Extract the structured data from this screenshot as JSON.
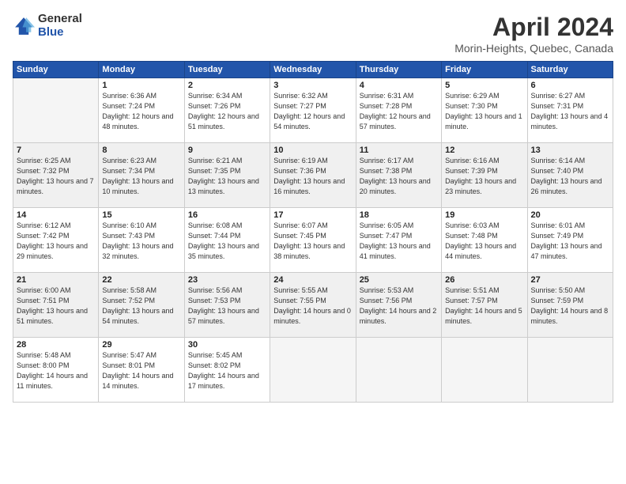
{
  "header": {
    "logo_general": "General",
    "logo_blue": "Blue",
    "month_title": "April 2024",
    "location": "Morin-Heights, Quebec, Canada"
  },
  "days_of_week": [
    "Sunday",
    "Monday",
    "Tuesday",
    "Wednesday",
    "Thursday",
    "Friday",
    "Saturday"
  ],
  "weeks": [
    [
      {
        "day": "",
        "empty": true
      },
      {
        "day": "1",
        "sunrise": "Sunrise: 6:36 AM",
        "sunset": "Sunset: 7:24 PM",
        "daylight": "Daylight: 12 hours and 48 minutes."
      },
      {
        "day": "2",
        "sunrise": "Sunrise: 6:34 AM",
        "sunset": "Sunset: 7:26 PM",
        "daylight": "Daylight: 12 hours and 51 minutes."
      },
      {
        "day": "3",
        "sunrise": "Sunrise: 6:32 AM",
        "sunset": "Sunset: 7:27 PM",
        "daylight": "Daylight: 12 hours and 54 minutes."
      },
      {
        "day": "4",
        "sunrise": "Sunrise: 6:31 AM",
        "sunset": "Sunset: 7:28 PM",
        "daylight": "Daylight: 12 hours and 57 minutes."
      },
      {
        "day": "5",
        "sunrise": "Sunrise: 6:29 AM",
        "sunset": "Sunset: 7:30 PM",
        "daylight": "Daylight: 13 hours and 1 minute."
      },
      {
        "day": "6",
        "sunrise": "Sunrise: 6:27 AM",
        "sunset": "Sunset: 7:31 PM",
        "daylight": "Daylight: 13 hours and 4 minutes."
      }
    ],
    [
      {
        "day": "7",
        "sunrise": "Sunrise: 6:25 AM",
        "sunset": "Sunset: 7:32 PM",
        "daylight": "Daylight: 13 hours and 7 minutes."
      },
      {
        "day": "8",
        "sunrise": "Sunrise: 6:23 AM",
        "sunset": "Sunset: 7:34 PM",
        "daylight": "Daylight: 13 hours and 10 minutes."
      },
      {
        "day": "9",
        "sunrise": "Sunrise: 6:21 AM",
        "sunset": "Sunset: 7:35 PM",
        "daylight": "Daylight: 13 hours and 13 minutes."
      },
      {
        "day": "10",
        "sunrise": "Sunrise: 6:19 AM",
        "sunset": "Sunset: 7:36 PM",
        "daylight": "Daylight: 13 hours and 16 minutes."
      },
      {
        "day": "11",
        "sunrise": "Sunrise: 6:17 AM",
        "sunset": "Sunset: 7:38 PM",
        "daylight": "Daylight: 13 hours and 20 minutes."
      },
      {
        "day": "12",
        "sunrise": "Sunrise: 6:16 AM",
        "sunset": "Sunset: 7:39 PM",
        "daylight": "Daylight: 13 hours and 23 minutes."
      },
      {
        "day": "13",
        "sunrise": "Sunrise: 6:14 AM",
        "sunset": "Sunset: 7:40 PM",
        "daylight": "Daylight: 13 hours and 26 minutes."
      }
    ],
    [
      {
        "day": "14",
        "sunrise": "Sunrise: 6:12 AM",
        "sunset": "Sunset: 7:42 PM",
        "daylight": "Daylight: 13 hours and 29 minutes."
      },
      {
        "day": "15",
        "sunrise": "Sunrise: 6:10 AM",
        "sunset": "Sunset: 7:43 PM",
        "daylight": "Daylight: 13 hours and 32 minutes."
      },
      {
        "day": "16",
        "sunrise": "Sunrise: 6:08 AM",
        "sunset": "Sunset: 7:44 PM",
        "daylight": "Daylight: 13 hours and 35 minutes."
      },
      {
        "day": "17",
        "sunrise": "Sunrise: 6:07 AM",
        "sunset": "Sunset: 7:45 PM",
        "daylight": "Daylight: 13 hours and 38 minutes."
      },
      {
        "day": "18",
        "sunrise": "Sunrise: 6:05 AM",
        "sunset": "Sunset: 7:47 PM",
        "daylight": "Daylight: 13 hours and 41 minutes."
      },
      {
        "day": "19",
        "sunrise": "Sunrise: 6:03 AM",
        "sunset": "Sunset: 7:48 PM",
        "daylight": "Daylight: 13 hours and 44 minutes."
      },
      {
        "day": "20",
        "sunrise": "Sunrise: 6:01 AM",
        "sunset": "Sunset: 7:49 PM",
        "daylight": "Daylight: 13 hours and 47 minutes."
      }
    ],
    [
      {
        "day": "21",
        "sunrise": "Sunrise: 6:00 AM",
        "sunset": "Sunset: 7:51 PM",
        "daylight": "Daylight: 13 hours and 51 minutes."
      },
      {
        "day": "22",
        "sunrise": "Sunrise: 5:58 AM",
        "sunset": "Sunset: 7:52 PM",
        "daylight": "Daylight: 13 hours and 54 minutes."
      },
      {
        "day": "23",
        "sunrise": "Sunrise: 5:56 AM",
        "sunset": "Sunset: 7:53 PM",
        "daylight": "Daylight: 13 hours and 57 minutes."
      },
      {
        "day": "24",
        "sunrise": "Sunrise: 5:55 AM",
        "sunset": "Sunset: 7:55 PM",
        "daylight": "Daylight: 14 hours and 0 minutes."
      },
      {
        "day": "25",
        "sunrise": "Sunrise: 5:53 AM",
        "sunset": "Sunset: 7:56 PM",
        "daylight": "Daylight: 14 hours and 2 minutes."
      },
      {
        "day": "26",
        "sunrise": "Sunrise: 5:51 AM",
        "sunset": "Sunset: 7:57 PM",
        "daylight": "Daylight: 14 hours and 5 minutes."
      },
      {
        "day": "27",
        "sunrise": "Sunrise: 5:50 AM",
        "sunset": "Sunset: 7:59 PM",
        "daylight": "Daylight: 14 hours and 8 minutes."
      }
    ],
    [
      {
        "day": "28",
        "sunrise": "Sunrise: 5:48 AM",
        "sunset": "Sunset: 8:00 PM",
        "daylight": "Daylight: 14 hours and 11 minutes."
      },
      {
        "day": "29",
        "sunrise": "Sunrise: 5:47 AM",
        "sunset": "Sunset: 8:01 PM",
        "daylight": "Daylight: 14 hours and 14 minutes."
      },
      {
        "day": "30",
        "sunrise": "Sunrise: 5:45 AM",
        "sunset": "Sunset: 8:02 PM",
        "daylight": "Daylight: 14 hours and 17 minutes."
      },
      {
        "day": "",
        "empty": true
      },
      {
        "day": "",
        "empty": true
      },
      {
        "day": "",
        "empty": true
      },
      {
        "day": "",
        "empty": true
      }
    ]
  ]
}
